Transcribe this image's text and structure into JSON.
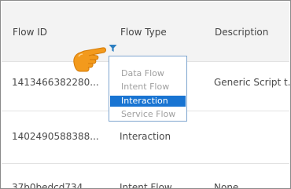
{
  "table": {
    "columns": [
      "Flow ID",
      "Flow Type",
      "Description"
    ],
    "rows": [
      {
        "flow_id": "1413466382280...",
        "flow_type": "",
        "description": "Generic Script t..."
      },
      {
        "flow_id": "1402490588388...",
        "flow_type": "Interaction",
        "description": ""
      },
      {
        "flow_id": "37b0bedcd734...",
        "flow_type": "Intent Flow",
        "description": "None"
      }
    ]
  },
  "filter": {
    "icon": "filter-icon",
    "options": [
      "Data Flow",
      "Intent Flow",
      "Interaction",
      "Service Flow"
    ],
    "selected": "Interaction"
  },
  "pointer": {
    "icon": "pointing-hand-icon"
  },
  "colors": {
    "header_bg": "#f3f3f3",
    "selected_bg": "#1874d2",
    "dropdown_border": "#7fa6cf",
    "filter_icon": "#2d7fc1",
    "hand": "#f39a1c"
  }
}
